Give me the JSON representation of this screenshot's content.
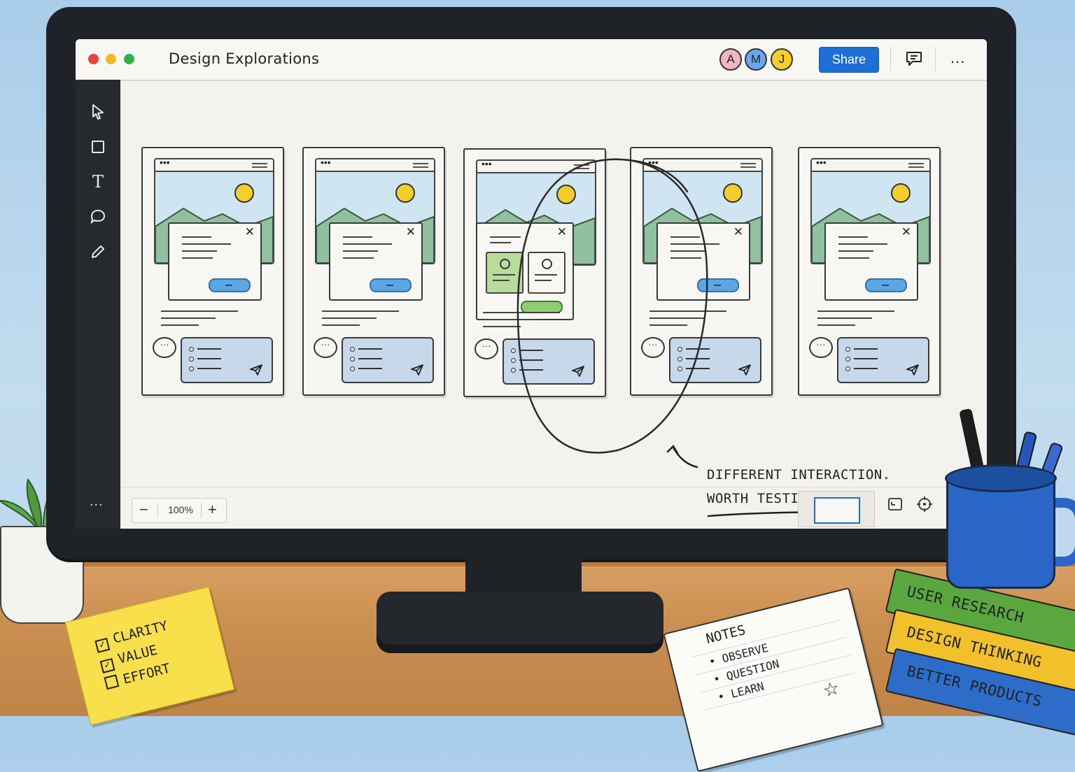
{
  "window": {
    "title": "Design Explorations",
    "traffic_lights": [
      "#e8453c",
      "#f4b92b",
      "#2fb24a"
    ]
  },
  "header": {
    "collaborators": [
      {
        "initial": "A",
        "color": "#f3b4c0"
      },
      {
        "initial": "M",
        "color": "#6aa6f2"
      },
      {
        "initial": "J",
        "color": "#f4cf2c"
      }
    ],
    "share_label": "Share",
    "accent": "#1d6fd6"
  },
  "toolbar": {
    "tools": [
      "cursor-icon",
      "rectangle-icon",
      "text-icon",
      "comment-icon",
      "pencil-icon"
    ],
    "text_tool_glyph": "T",
    "more_glyph": "..."
  },
  "canvas": {
    "card_count": 5,
    "highlighted_card": 3,
    "annotation": {
      "line1": "DIFFERENT INTERACTION.",
      "line2": "WORTH TESTING."
    }
  },
  "zoom": {
    "value": "100%",
    "minus": "−",
    "plus": "+"
  },
  "desk": {
    "sticky_note": [
      {
        "label": "CLARITY",
        "checked": true
      },
      {
        "label": "VALUE",
        "checked": true
      },
      {
        "label": "EFFORT",
        "checked": false
      }
    ],
    "notebook": {
      "title": "NOTES",
      "items": [
        "OBSERVE",
        "QUESTION",
        "LEARN"
      ]
    },
    "books": [
      {
        "title": "USER RESEARCH",
        "color": "#5aa63f"
      },
      {
        "title": "DESIGN THINKING",
        "color": "#f2c02a"
      },
      {
        "title": "BETTER PRODUCTS",
        "color": "#2d6cc8"
      }
    ]
  }
}
